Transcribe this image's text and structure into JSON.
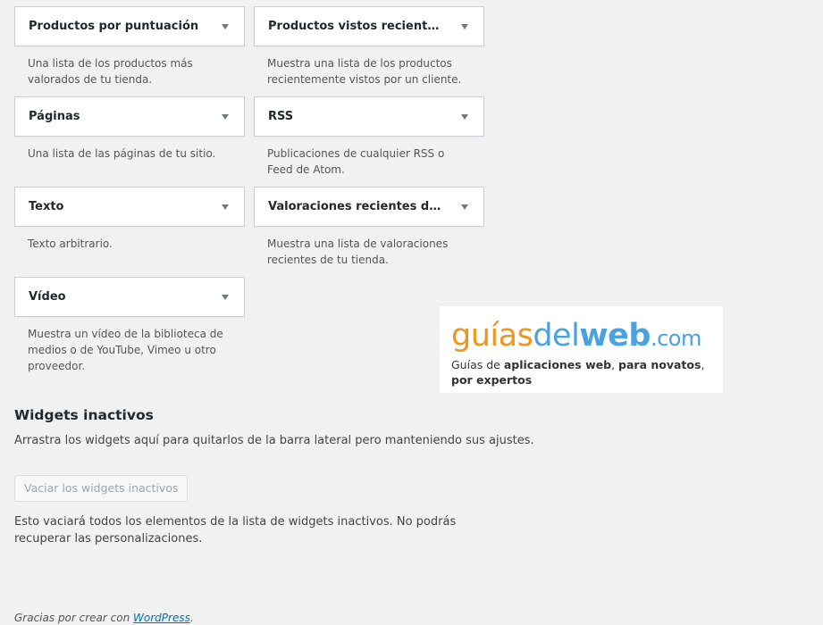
{
  "widgets": [
    {
      "title": "Productos por puntuación",
      "description": "Una lista de los productos más valorados de tu tienda."
    },
    {
      "title": "Productos vistos recientem…",
      "description": "Muestra una lista de los productos recientemente vistos por un cliente."
    },
    {
      "title": "Páginas",
      "description": "Una lista de las páginas de tu sitio."
    },
    {
      "title": "RSS",
      "description": "Publicaciones de cualquier RSS o Feed de Atom."
    },
    {
      "title": "Texto",
      "description": "Texto arbitrario."
    },
    {
      "title": "Valoraciones recientes de …",
      "description": "Muestra una lista de valoraciones recientes de tu tienda."
    },
    {
      "title": "Vídeo",
      "description": "Muestra un vídeo de la biblioteca de medios o de YouTube, Vimeo u otro proveedor."
    }
  ],
  "logo": {
    "part1": "guías",
    "part2": "del",
    "part3": "web",
    "part4": ".com",
    "tag_1": "Guías de ",
    "tag_2": "aplicaciones web",
    "tag_3": ", ",
    "tag_4": "para novatos",
    "tag_5": ", ",
    "tag_6": "por expertos"
  },
  "inactive": {
    "heading": "Widgets inactivos",
    "description": "Arrastra los widgets aquí para quitarlos de la barra lateral pero manteniendo sus ajustes.",
    "clear_button": "Vaciar los widgets inactivos",
    "note": "Esto vaciará todos los elementos de la lista de widgets inactivos. No podrás recuperar las personalizaciones."
  },
  "footer": {
    "prefix": "Gracias por crear con ",
    "link": "WordPress",
    "suffix": "."
  },
  "icons": {
    "widget_toggle": "triangle-down-icon"
  },
  "colors": {
    "background": "#f1f1f1",
    "link": "#0073aa",
    "logo_orange": "#f0961e",
    "logo_blue": "#4aa3df"
  }
}
